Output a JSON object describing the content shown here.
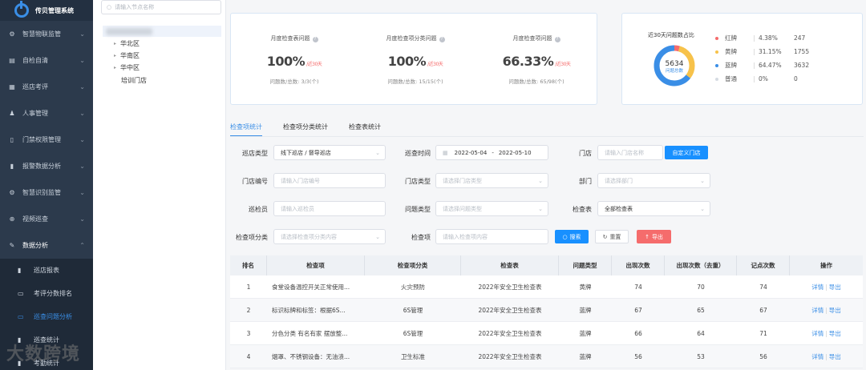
{
  "app": {
    "title": "传贝管理系统"
  },
  "sidebar": {
    "items": [
      {
        "label": "智慧物联监管",
        "icon": "gear-icon"
      },
      {
        "label": "自检自清",
        "icon": "clipboard-icon"
      },
      {
        "label": "巡店考评",
        "icon": "list-icon"
      },
      {
        "label": "人事管理",
        "icon": "person-icon"
      },
      {
        "label": "门禁权限管理",
        "icon": "door-icon"
      },
      {
        "label": "报警数据分析",
        "icon": "document-icon"
      },
      {
        "label": "智慧识别监管",
        "icon": "gear-icon"
      },
      {
        "label": "视频巡查",
        "icon": "plus-circle-icon"
      },
      {
        "label": "数据分析",
        "icon": "edit-icon"
      }
    ],
    "sub_items": [
      {
        "label": "巡店报表",
        "icon": "file-icon"
      },
      {
        "label": "考评分数排名",
        "icon": "monitor-icon"
      },
      {
        "label": "巡查问题分析",
        "icon": "monitor-icon"
      },
      {
        "label": "巡查统计",
        "icon": "chart-icon"
      },
      {
        "label": "考勤统计",
        "icon": "file-icon"
      }
    ]
  },
  "tree": {
    "search_placeholder": "请输入节点名称",
    "nodes": [
      "华北区",
      "华南区",
      "华中区",
      "培训门店"
    ]
  },
  "stats": [
    {
      "title": "月度检查表问题",
      "value": "100%",
      "suffix": "/近30天",
      "sub": "问题数/总数: 3/3(个)"
    },
    {
      "title": "月度检查项分类问题",
      "value": "100%",
      "suffix": "/近30天",
      "sub": "问题数/总数: 15/15(个)"
    },
    {
      "title": "月度检查项问题",
      "value": "66.33%",
      "suffix": "/近30天",
      "sub": "问题数/总数: 65/98(个)"
    }
  ],
  "donut": {
    "title": "近30天问题数占比",
    "center_value": "5634",
    "center_label": "问题总数",
    "legend": [
      {
        "name": "红牌",
        "percent": "4.38%",
        "count": "247",
        "color": "#f56c6c",
        "fraction": 0.0438
      },
      {
        "name": "黄牌",
        "percent": "31.15%",
        "count": "1755",
        "color": "#f7c24a",
        "fraction": 0.3115
      },
      {
        "name": "蓝牌",
        "percent": "64.47%",
        "count": "3632",
        "color": "#3a8ee6",
        "fraction": 0.6447
      },
      {
        "name": "普通",
        "percent": "0%",
        "count": "0",
        "color": "#d6dbe2",
        "fraction": 0
      }
    ]
  },
  "tabs": [
    "检查项统计",
    "检查项分类统计",
    "检查表统计"
  ],
  "form": {
    "store_type_label": "巡店类型",
    "store_type_value": "线下巡店 / 督导巡店",
    "time_label": "巡查时间",
    "date_start": "2022-05-04",
    "date_sep": "-",
    "date_end": "2022-05-10",
    "store_label": "门店",
    "store_placeholder": "请输入门店名称",
    "custom_store_btn": "自定义门店",
    "store_no_label": "门店编号",
    "store_no_placeholder": "请输入门店编号",
    "store_kind_label": "门店类型",
    "store_kind_placeholder": "请选择门店类型",
    "dept_label": "部门",
    "dept_placeholder": "请选择部门",
    "inspector_label": "巡检员",
    "inspector_placeholder": "请输入巡检员",
    "issue_type_label": "问题类型",
    "issue_type_placeholder": "请选择问题类型",
    "checklist_label": "检查表",
    "checklist_value": "全部检查表",
    "item_cat_label": "检查项分类",
    "item_cat_placeholder": "请选择检查项分类内容",
    "item_label": "检查项",
    "item_placeholder": "请输入检查项内容",
    "search_btn": "搜索",
    "reset_btn": "重置",
    "export_btn": "导出"
  },
  "table": {
    "headers": [
      "排名",
      "检查项",
      "检查项分类",
      "检查表",
      "问题类型",
      "出现次数",
      "出现次数（去重）",
      "记点次数",
      "操作"
    ],
    "rows": [
      {
        "rank": "1",
        "item": "食堂设备温控开关正常使用...",
        "category": "火灾预防",
        "sheet": "2022年安全卫生检查表",
        "type": "黄牌",
        "count": "74",
        "dedup": "70",
        "points": "74"
      },
      {
        "rank": "2",
        "item": "标识标牌和标签：根据6S...",
        "category": "6S管理",
        "sheet": "2022年安全卫生检查表",
        "type": "蓝牌",
        "count": "67",
        "dedup": "65",
        "points": "67"
      },
      {
        "rank": "3",
        "item": "分色分类 有名有家 摆放整...",
        "category": "6S管理",
        "sheet": "2022年安全卫生检查表",
        "type": "蓝牌",
        "count": "66",
        "dedup": "64",
        "points": "71"
      },
      {
        "rank": "4",
        "item": "烟罩、不锈钢设备：无油渍...",
        "category": "卫生标准",
        "sheet": "2022年安全卫生检查表",
        "type": "蓝牌",
        "count": "56",
        "dedup": "53",
        "points": "56"
      }
    ],
    "action_detail": "详情",
    "action_sep": "|",
    "action_export": "导出"
  },
  "watermark": "大数跨境"
}
